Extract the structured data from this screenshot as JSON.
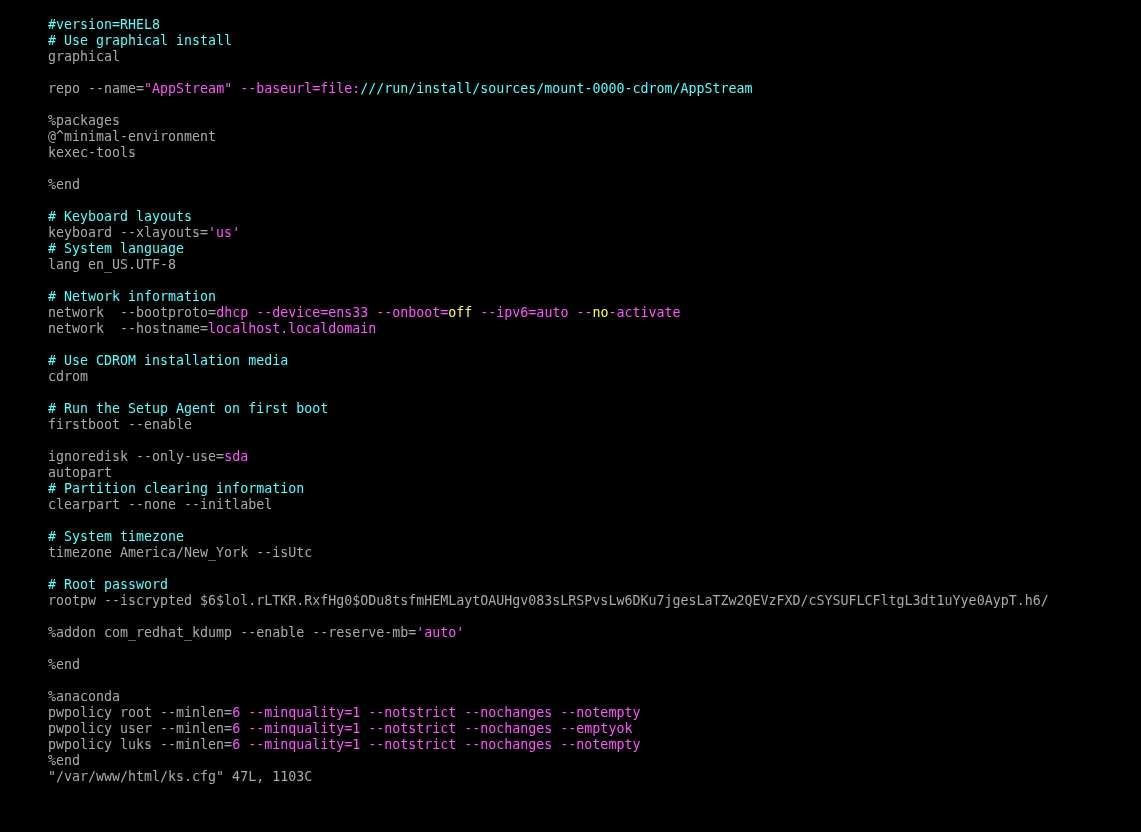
{
  "editor": {
    "lines": [
      {
        "kind": "code",
        "segments": [
          {
            "text": "#version=RHEL8",
            "kind": "comment"
          }
        ]
      },
      {
        "kind": "code",
        "segments": [
          {
            "text": "# Use graphical install",
            "kind": "comment"
          }
        ]
      },
      {
        "kind": "code",
        "segments": [
          {
            "text": "graphical",
            "kind": "plain"
          }
        ]
      },
      {
        "kind": "blank"
      },
      {
        "kind": "code",
        "segments": [
          {
            "text": "repo --name=",
            "kind": "plain"
          },
          {
            "text": "\"AppStream\" --baseurl=file:",
            "kind": "string"
          },
          {
            "text": "///run/install/sources/mount-0000-cdrom/AppStream",
            "kind": "comment"
          }
        ]
      },
      {
        "kind": "blank"
      },
      {
        "kind": "code",
        "segments": [
          {
            "text": "%packages",
            "kind": "plain"
          }
        ]
      },
      {
        "kind": "code",
        "segments": [
          {
            "text": "@^minimal-environment",
            "kind": "plain"
          }
        ]
      },
      {
        "kind": "code",
        "segments": [
          {
            "text": "kexec-tools",
            "kind": "plain"
          }
        ]
      },
      {
        "kind": "blank"
      },
      {
        "kind": "code",
        "segments": [
          {
            "text": "%end",
            "kind": "plain"
          }
        ]
      },
      {
        "kind": "blank"
      },
      {
        "kind": "code",
        "segments": [
          {
            "text": "# Keyboard layouts",
            "kind": "comment"
          }
        ]
      },
      {
        "kind": "code",
        "segments": [
          {
            "text": "keyboard --xlayouts=",
            "kind": "plain"
          },
          {
            "text": "'us'",
            "kind": "string"
          }
        ]
      },
      {
        "kind": "code",
        "segments": [
          {
            "text": "# System language",
            "kind": "comment"
          }
        ]
      },
      {
        "kind": "code",
        "segments": [
          {
            "text": "lang en_US.UTF-8",
            "kind": "plain"
          }
        ]
      },
      {
        "kind": "blank"
      },
      {
        "kind": "code",
        "segments": [
          {
            "text": "# Network information",
            "kind": "comment"
          }
        ]
      },
      {
        "kind": "code",
        "segments": [
          {
            "text": "network  --bootproto=",
            "kind": "plain"
          },
          {
            "text": "dhcp --device=ens33 --onboot=",
            "kind": "string"
          },
          {
            "text": "off",
            "kind": "keyword"
          },
          {
            "text": " --ipv6=auto --",
            "kind": "string"
          },
          {
            "text": "no",
            "kind": "keyword"
          },
          {
            "text": "-activate",
            "kind": "string"
          }
        ]
      },
      {
        "kind": "code",
        "segments": [
          {
            "text": "network  --hostname=",
            "kind": "plain"
          },
          {
            "text": "localhost.localdomain",
            "kind": "string"
          }
        ]
      },
      {
        "kind": "blank"
      },
      {
        "kind": "code",
        "segments": [
          {
            "text": "# Use CDROM installation media",
            "kind": "comment"
          }
        ]
      },
      {
        "kind": "code",
        "segments": [
          {
            "text": "cdrom",
            "kind": "plain"
          }
        ]
      },
      {
        "kind": "blank"
      },
      {
        "kind": "code",
        "segments": [
          {
            "text": "# Run the Setup Agent on first boot",
            "kind": "comment"
          }
        ]
      },
      {
        "kind": "code",
        "segments": [
          {
            "text": "firstboot --enable",
            "kind": "plain"
          }
        ]
      },
      {
        "kind": "blank"
      },
      {
        "kind": "code",
        "segments": [
          {
            "text": "ignoredisk --only-use=",
            "kind": "plain"
          },
          {
            "text": "sda",
            "kind": "string"
          }
        ]
      },
      {
        "kind": "code",
        "segments": [
          {
            "text": "autopart",
            "kind": "plain"
          }
        ]
      },
      {
        "kind": "code",
        "segments": [
          {
            "text": "# Partition clearing information",
            "kind": "comment"
          }
        ]
      },
      {
        "kind": "code",
        "segments": [
          {
            "text": "clearpart --none --initlabel",
            "kind": "plain"
          }
        ]
      },
      {
        "kind": "blank"
      },
      {
        "kind": "code",
        "segments": [
          {
            "text": "# System timezone",
            "kind": "comment"
          }
        ]
      },
      {
        "kind": "code",
        "segments": [
          {
            "text": "timezone America/New_York --isUtc",
            "kind": "plain"
          }
        ]
      },
      {
        "kind": "blank"
      },
      {
        "kind": "code",
        "segments": [
          {
            "text": "# Root password",
            "kind": "comment"
          }
        ]
      },
      {
        "kind": "code",
        "segments": [
          {
            "text": "rootpw --iscrypted $6$lol.rLTKR.RxfHg0$ODu8tsfmHEMLaytOAUHgv083sLRSPvsLw6DKu7jgesLaTZw2QEVzFXD/cSYSUFLCFltgL3dt1uYye0AypT.h6/",
            "kind": "plain"
          }
        ]
      },
      {
        "kind": "blank"
      },
      {
        "kind": "code",
        "segments": [
          {
            "text": "%addon com_redhat_kdump --enable --reserve-mb=",
            "kind": "plain"
          },
          {
            "text": "'auto'",
            "kind": "string"
          }
        ]
      },
      {
        "kind": "blank"
      },
      {
        "kind": "code",
        "segments": [
          {
            "text": "%end",
            "kind": "plain"
          }
        ]
      },
      {
        "kind": "blank"
      },
      {
        "kind": "code",
        "segments": [
          {
            "text": "%anaconda",
            "kind": "plain"
          }
        ]
      },
      {
        "kind": "code",
        "segments": [
          {
            "text": "pwpolicy root --minlen=",
            "kind": "plain"
          },
          {
            "text": "6 --minquality=1 --notstrict --nochanges --notempty",
            "kind": "string"
          }
        ]
      },
      {
        "kind": "code",
        "segments": [
          {
            "text": "pwpolicy user --minlen=",
            "kind": "plain"
          },
          {
            "text": "6 --minquality=1 --notstrict --nochanges --emptyok",
            "kind": "string"
          }
        ]
      },
      {
        "kind": "code",
        "segments": [
          {
            "text": "pwpolicy luks --minlen=",
            "kind": "plain"
          },
          {
            "text": "6 --minquality=1 --notstrict --nochanges --notempty",
            "kind": "string"
          }
        ]
      },
      {
        "kind": "code",
        "segments": [
          {
            "text": "%end",
            "kind": "plain"
          }
        ]
      }
    ],
    "status_line": "\"/var/www/html/ks.cfg\" 47L, 1103C"
  }
}
